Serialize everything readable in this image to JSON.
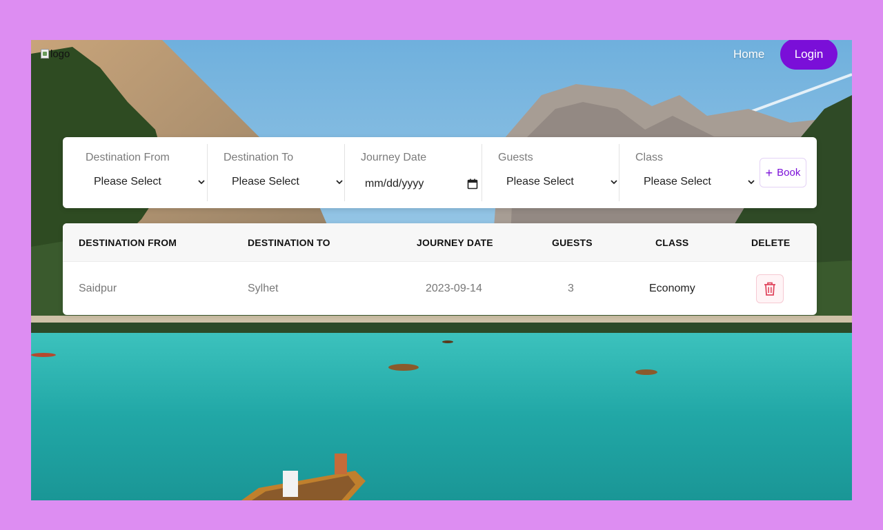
{
  "nav": {
    "logo_alt": "logo",
    "home_label": "Home",
    "login_label": "Login"
  },
  "form": {
    "fields": [
      {
        "label": "Destination From",
        "value": "Please Select"
      },
      {
        "label": "Destination To",
        "value": "Please Select"
      },
      {
        "label": "Journey Date",
        "value": "mm/dd/yyyy"
      },
      {
        "label": "Guests",
        "value": "Please Select"
      },
      {
        "label": "Class",
        "value": "Please Select"
      }
    ],
    "book_label": "Book"
  },
  "table": {
    "headers": [
      "DESTINATION FROM",
      "DESTINATION TO",
      "JOURNEY DATE",
      "GUESTS",
      "CLASS",
      "DELETE"
    ],
    "rows": [
      {
        "from": "Saidpur",
        "to": "Sylhet",
        "date": "2023-09-14",
        "guests": "3",
        "class": "Economy"
      }
    ]
  },
  "colors": {
    "page_bg": "#dd8df2",
    "accent": "#7a0fd8",
    "delete": "#e0465e",
    "lake": "#2fb8b3"
  },
  "icons": [
    "chevron-down-icon",
    "calendar-icon",
    "plus-icon",
    "trash-icon"
  ]
}
